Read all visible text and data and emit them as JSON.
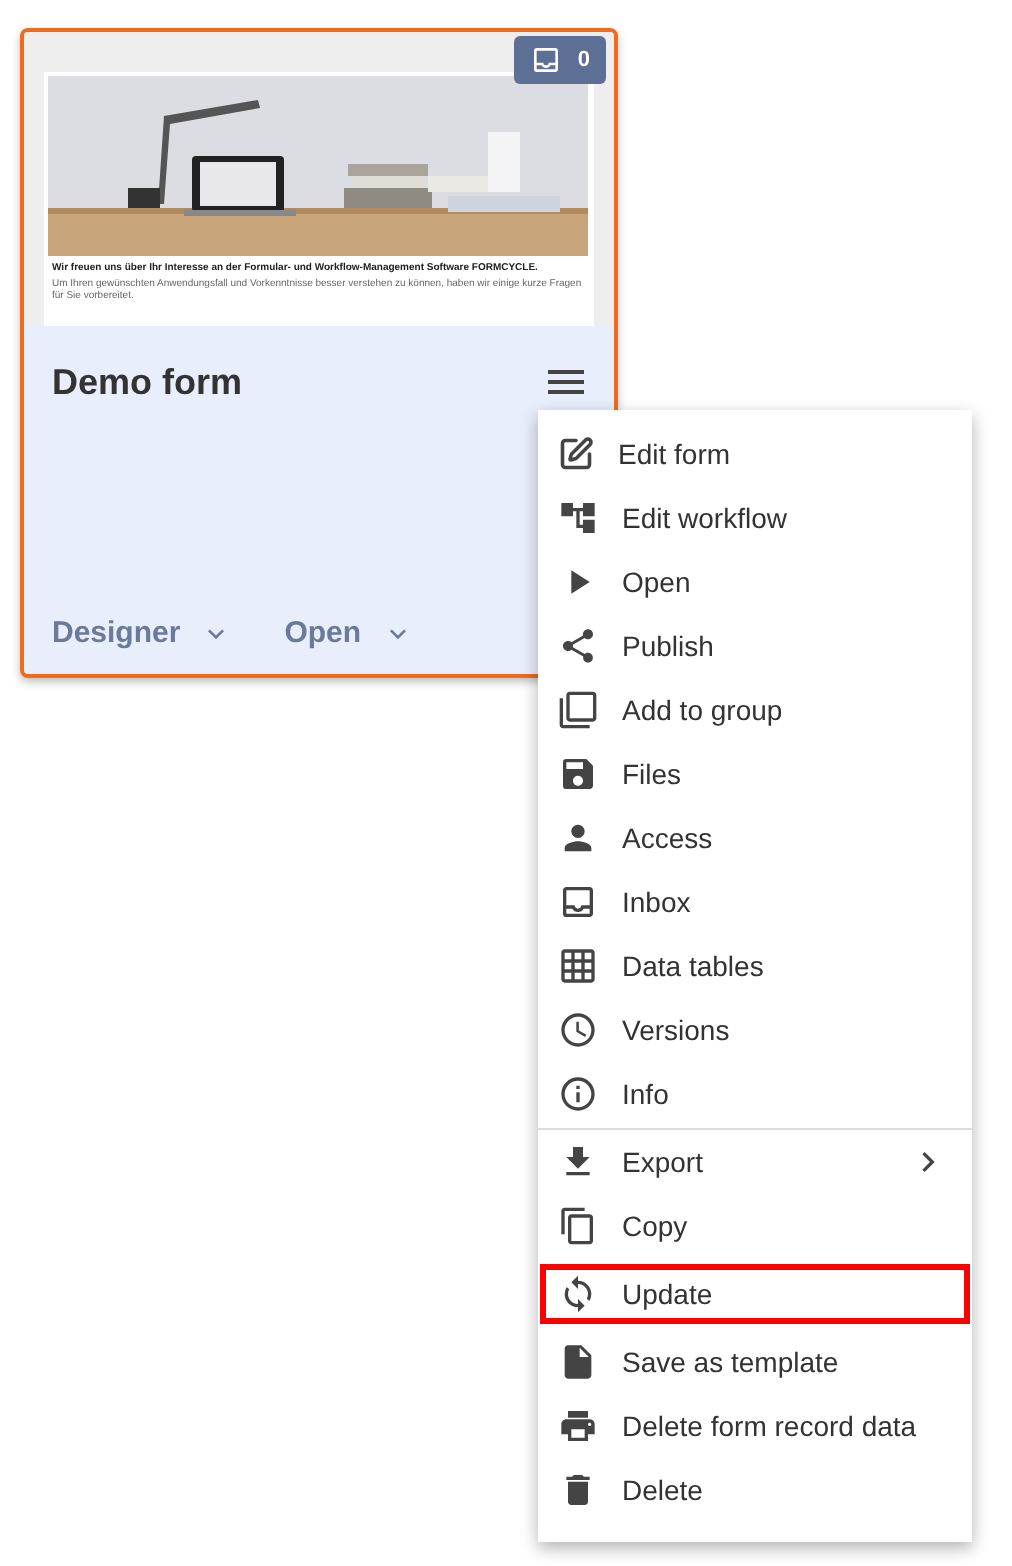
{
  "form_card": {
    "badge": "0",
    "selected": true,
    "preview": {
      "heading": "Wir freuen uns über Ihr Interesse an der Formular- und Workflow-Management Software FORMCYCLE.",
      "body": "Um Ihren gewünschten Anwendungsfall und Vorkenntnisse besser verstehen zu können, haben wir einige kurze Fragen für Sie vorbereitet."
    },
    "title": "Demo form",
    "actions": [
      "Designer",
      "Open"
    ]
  },
  "context_menu": {
    "sections": [
      {
        "items": [
          {
            "label": "Edit form",
            "submenu": false,
            "highlighted": false
          },
          {
            "label": "Edit workflow",
            "submenu": false,
            "highlighted": false
          },
          {
            "label": "Open",
            "submenu": false,
            "highlighted": false
          },
          {
            "label": "Publish",
            "submenu": false,
            "highlighted": false
          },
          {
            "label": "Add to group",
            "submenu": false,
            "highlighted": false
          },
          {
            "label": "Files",
            "submenu": false,
            "highlighted": false
          },
          {
            "label": "Access",
            "submenu": false,
            "highlighted": false
          },
          {
            "label": "Inbox",
            "submenu": false,
            "highlighted": false
          },
          {
            "label": "Data tables",
            "submenu": false,
            "highlighted": false
          },
          {
            "label": "Versions",
            "submenu": false,
            "highlighted": false
          },
          {
            "label": "Info",
            "submenu": false,
            "highlighted": false
          }
        ]
      },
      {
        "items": [
          {
            "label": "Export",
            "submenu": true,
            "highlighted": false
          },
          {
            "label": "Copy",
            "submenu": false,
            "highlighted": false
          },
          {
            "label": "Update",
            "submenu": false,
            "highlighted": true
          },
          {
            "label": "Save as template",
            "submenu": false,
            "highlighted": false
          },
          {
            "label": "Delete form record data",
            "submenu": false,
            "highlighted": false
          },
          {
            "label": "Delete",
            "submenu": false,
            "highlighted": false
          }
        ]
      }
    ]
  }
}
